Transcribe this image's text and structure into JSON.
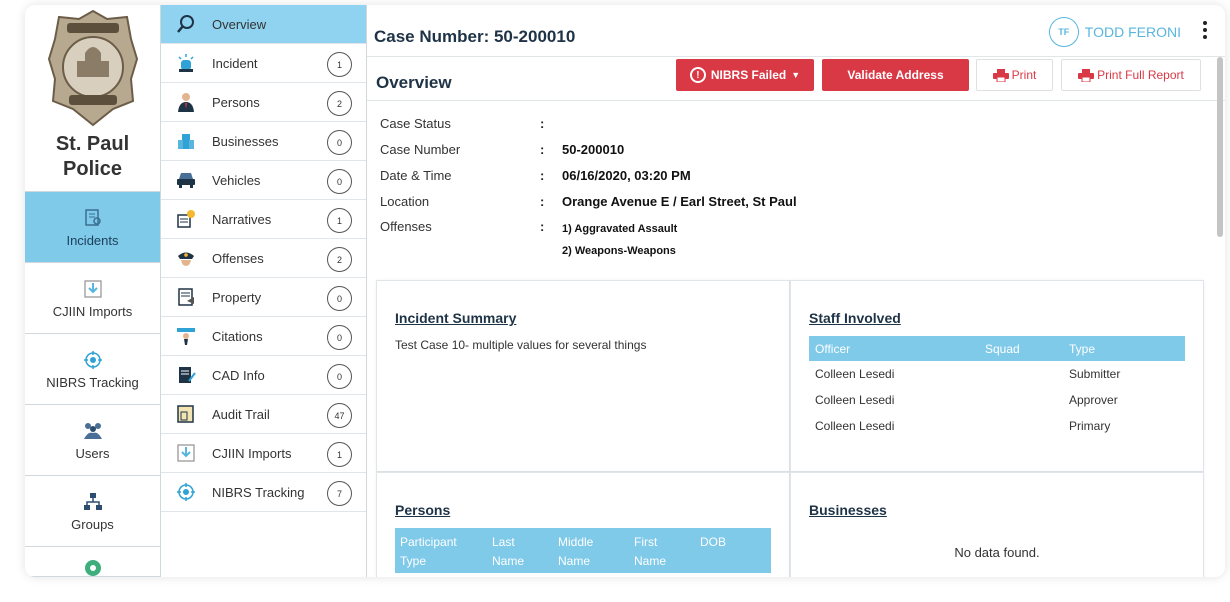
{
  "brand": {
    "line1": "St. Paul",
    "line2": "Police"
  },
  "rail": [
    {
      "label": "Incidents",
      "icon": "incidents-icon",
      "active": true
    },
    {
      "label": "CJIIN Imports",
      "icon": "import-icon"
    },
    {
      "label": "NIBRS Tracking",
      "icon": "tracking-icon"
    },
    {
      "label": "Users",
      "icon": "users-icon"
    },
    {
      "label": "Groups",
      "icon": "groups-icon"
    }
  ],
  "subnav": [
    {
      "label": "Overview",
      "count": null,
      "icon": "search-icon",
      "active": true
    },
    {
      "label": "Incident",
      "count": "1",
      "icon": "siren-icon"
    },
    {
      "label": "Persons",
      "count": "2",
      "icon": "person-icon"
    },
    {
      "label": "Businesses",
      "count": "0",
      "icon": "building-icon"
    },
    {
      "label": "Vehicles",
      "count": "0",
      "icon": "car-icon"
    },
    {
      "label": "Narratives",
      "count": "1",
      "icon": "narrative-icon"
    },
    {
      "label": "Offenses",
      "count": "2",
      "icon": "police-hat-icon"
    },
    {
      "label": "Property",
      "count": "0",
      "icon": "property-icon"
    },
    {
      "label": "Citations",
      "count": "0",
      "icon": "citation-icon"
    },
    {
      "label": "CAD Info",
      "count": "0",
      "icon": "cad-icon"
    },
    {
      "label": "Audit Trail",
      "count": "47",
      "icon": "audit-icon"
    },
    {
      "label": "CJIIN Imports",
      "count": "1",
      "icon": "import-icon"
    },
    {
      "label": "NIBRS Tracking",
      "count": "7",
      "icon": "tracking-icon"
    }
  ],
  "header": {
    "case_title": "Case Number: 50-200010",
    "user_initials": "TF",
    "user_name": "TODD FERONI"
  },
  "overview": {
    "title": "Overview",
    "nibrs_button": "NIBRS Failed",
    "validate_button": "Validate Address",
    "print_button": "Print",
    "print_full_button": "Print Full Report"
  },
  "details": {
    "status_label": "Case Status",
    "status_value": "",
    "number_label": "Case Number",
    "number_value": "50-200010",
    "datetime_label": "Date & Time",
    "datetime_value": "06/16/2020, 03:20 PM",
    "location_label": "Location",
    "location_value": "Orange Avenue E / Earl Street, St Paul",
    "offenses_label": "Offenses",
    "offense_1": "1) Aggravated Assault",
    "offense_2": "2) Weapons-Weapons",
    "colon": ":"
  },
  "incident_summary": {
    "title": "Incident Summary",
    "text": "Test Case 10- multiple values for several things"
  },
  "staff": {
    "title": "Staff Involved",
    "headers": {
      "officer": "Officer",
      "squad": "Squad",
      "type": "Type"
    },
    "rows": [
      {
        "officer": "Colleen Lesedi",
        "squad": "",
        "type": "Submitter"
      },
      {
        "officer": "Colleen Lesedi",
        "squad": "",
        "type": "Approver"
      },
      {
        "officer": "Colleen Lesedi",
        "squad": "",
        "type": "Primary"
      }
    ]
  },
  "persons": {
    "title": "Persons",
    "headers": {
      "participant": "Participant Type",
      "last": "Last Name",
      "middle": "Middle Name",
      "first": "First Name",
      "dob": "DOB"
    }
  },
  "businesses": {
    "title": "Businesses",
    "empty": "No data found."
  },
  "colors": {
    "accent_blue": "#7fc9e9",
    "active_blue": "#8fd3f0",
    "danger_red": "#d93845",
    "heading": "#1f3347"
  }
}
